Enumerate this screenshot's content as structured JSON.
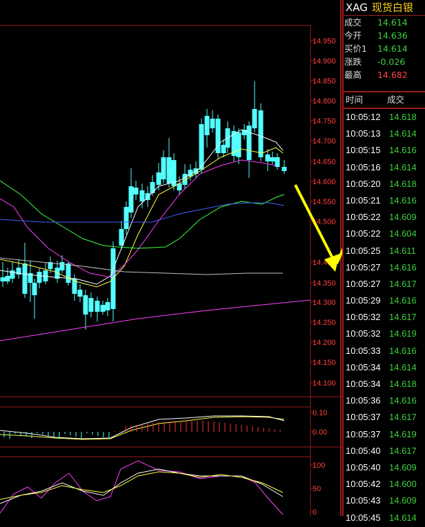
{
  "quote": {
    "code": "XAG",
    "name": "现货白银",
    "rows": [
      {
        "label": "成交",
        "value": "14.614",
        "color": "green"
      },
      {
        "label": "今开",
        "value": "14.636",
        "color": "green"
      },
      {
        "label": "买价1",
        "value": "14.614",
        "color": "green"
      },
      {
        "label": "涨跌",
        "value": "-0.026",
        "color": "green"
      },
      {
        "label": "最高",
        "value": "14.682",
        "color": "red"
      }
    ]
  },
  "trades": {
    "header_time": "时间",
    "header_price": "成交",
    "rows": [
      {
        "time": "10:05:12",
        "price": "14.618",
        "color": "green"
      },
      {
        "time": "10:05:13",
        "price": "14.614",
        "color": "green"
      },
      {
        "time": "10:05:15",
        "price": "14.616",
        "color": "green"
      },
      {
        "time": "10:05:16",
        "price": "14.614",
        "color": "green"
      },
      {
        "time": "10:05:20",
        "price": "14.618",
        "color": "green"
      },
      {
        "time": "10:05:21",
        "price": "14.616",
        "color": "green"
      },
      {
        "time": "10:05:22",
        "price": "14.609",
        "color": "green"
      },
      {
        "time": "10:05:22",
        "price": "14.604",
        "color": "green"
      },
      {
        "time": "10:05:25",
        "price": "14.611",
        "color": "green"
      },
      {
        "time": "10:05:27",
        "price": "14.616",
        "color": "green"
      },
      {
        "time": "10:05:27",
        "price": "14.617",
        "color": "green"
      },
      {
        "time": "10:05:29",
        "price": "14.616",
        "color": "green"
      },
      {
        "time": "10:05:32",
        "price": "14.617",
        "color": "green"
      },
      {
        "time": "10:05:32",
        "price": "14.619",
        "color": "green"
      },
      {
        "time": "10:05:33",
        "price": "14.616",
        "color": "green"
      },
      {
        "time": "10:05:34",
        "price": "14.614",
        "color": "green"
      },
      {
        "time": "10:05:34",
        "price": "14.618",
        "color": "green"
      },
      {
        "time": "10:05:36",
        "price": "14.616",
        "color": "green"
      },
      {
        "time": "10:05:37",
        "price": "14.617",
        "color": "green"
      },
      {
        "time": "10:05:37",
        "price": "14.619",
        "color": "green"
      },
      {
        "time": "10:05:40",
        "price": "14.617",
        "color": "green"
      },
      {
        "time": "10:05:40",
        "price": "14.609",
        "color": "green"
      },
      {
        "time": "10:05:42",
        "price": "14.600",
        "color": "green"
      },
      {
        "time": "10:05:43",
        "price": "14.609",
        "color": "green"
      },
      {
        "time": "10:05:45",
        "price": "14.614",
        "color": "green"
      }
    ]
  },
  "chart": {
    "price_axis": [
      "14.950",
      "14.900",
      "14.850",
      "14.800",
      "14.750",
      "14.700",
      "14.650",
      "14.600",
      "14.550",
      "14.500",
      "14.400",
      "14.350",
      "14.300",
      "14.250",
      "14.200",
      "14.150",
      "14.100"
    ],
    "macd_axis": [
      "0.10",
      "0.00"
    ],
    "kdj_axis": [
      "100",
      "50",
      "0"
    ]
  },
  "colors": {
    "up": "#ff3232",
    "down": "#54ffff",
    "ma5": "#ffffff",
    "ma10": "#ffff40",
    "ma20": "#ff40ff",
    "ma40": "#40ff40",
    "ma60": "#4060ff",
    "arrow": "#ffff00",
    "grid": "#9b1c1c"
  }
}
